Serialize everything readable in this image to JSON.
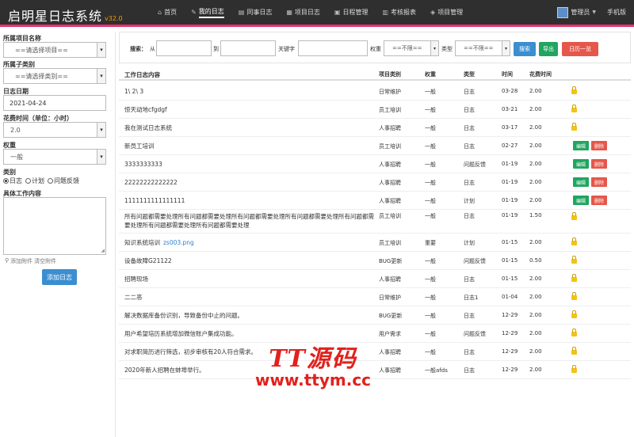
{
  "app": {
    "title": "启明星日志系统",
    "version": "v32.0"
  },
  "nav": [
    {
      "label": "首页",
      "icon": "home-icon",
      "glyph": "⌂"
    },
    {
      "label": "我的日志",
      "icon": "edit-icon",
      "glyph": "✎"
    },
    {
      "label": "同事日志",
      "icon": "list-icon",
      "glyph": "▤"
    },
    {
      "label": "项目日志",
      "icon": "grid-icon",
      "glyph": "▦"
    },
    {
      "label": "日程管理",
      "icon": "calendar-icon",
      "glyph": "▣"
    },
    {
      "label": "考核报表",
      "icon": "chart-icon",
      "glyph": "▥"
    },
    {
      "label": "项目管理",
      "icon": "tag-icon",
      "glyph": "◈"
    }
  ],
  "user": {
    "name": "管理员",
    "mobile": "手机版"
  },
  "form": {
    "project_label": "所属项目名称",
    "project_value": "==请选择项目==",
    "category_label": "所属子类别",
    "category_value": "==请选择类别==",
    "date_label": "日志日期",
    "date_value": "2021-04-24",
    "hours_label": "花费时间（单位：小时）",
    "hours_value": "2.0",
    "weight_label": "权重",
    "weight_value": "一般",
    "type_label": "类别",
    "types": [
      "日志",
      "计划",
      "问题反馈"
    ],
    "content_label": "具体工作内容",
    "attach_label": "添加附件",
    "clear_label": "清空附件",
    "submit_label": "添加日志"
  },
  "search": {
    "label": "搜索：",
    "from": "从",
    "to": "到",
    "keyword": "关键字",
    "weight": "权重",
    "weight_value": "==不限==",
    "type": "类型",
    "type_value": "==不限==",
    "search_btn": "搜索",
    "export_btn": "导出",
    "calendar_btn": "日历一览"
  },
  "table": {
    "headers": [
      "工作日志内容",
      "项目类别",
      "权重",
      "类型",
      "时间",
      "花费时间"
    ],
    "edit_label": "编辑",
    "delete_label": "删除",
    "rows": [
      {
        "content": "1\\ 2\\ 3",
        "cat": "日常维护",
        "weight": "一般",
        "type": "日志",
        "time": "03-28",
        "hours": "2.00",
        "ops": false
      },
      {
        "content": "惊天动地cfgdgf",
        "cat": "员工培训",
        "weight": "一般",
        "type": "日志",
        "time": "03-21",
        "hours": "2.00",
        "ops": false
      },
      {
        "content": "我在测试日志系统",
        "cat": "人事招聘",
        "weight": "一般",
        "type": "日志",
        "time": "03-17",
        "hours": "2.00",
        "ops": false
      },
      {
        "content": "新员工培训",
        "cat": "员工培训",
        "weight": "一般",
        "type": "日志",
        "time": "02-27",
        "hours": "2.00",
        "ops": true
      },
      {
        "content": "3333333333",
        "cat": "人事招聘",
        "weight": "一般",
        "type": "问题反馈",
        "time": "01-19",
        "hours": "2.00",
        "ops": true
      },
      {
        "content": "22222222222222",
        "cat": "人事招聘",
        "weight": "一般",
        "type": "日志",
        "time": "01-19",
        "hours": "2.00",
        "ops": true
      },
      {
        "content": "1111111111111111",
        "cat": "人事招聘",
        "weight": "一般",
        "type": "计划",
        "time": "01-19",
        "hours": "2.00",
        "ops": true
      },
      {
        "content": "所有问题都需要处理所有问题都需要处理所有问题都需要处理所有问题都需要处理所有问题都需要处理所有问题都需要处理所有问题都需要处理",
        "cat": "员工培训",
        "weight": "一般",
        "type": "日志",
        "time": "01-19",
        "hours": "1.50",
        "ops": false,
        "tall": true
      },
      {
        "content": "知识系统培训",
        "attachment": "zs003.png",
        "cat": "员工培训",
        "weight": "重要",
        "type": "计划",
        "time": "01-15",
        "hours": "2.00",
        "ops": false
      },
      {
        "content": "设备故障G21122",
        "cat": "BUG更新",
        "weight": "一般",
        "type": "问题反馈",
        "time": "01-15",
        "hours": "0.50",
        "ops": false
      },
      {
        "content": "招聘现场",
        "cat": "人事招聘",
        "weight": "一般",
        "type": "日志",
        "time": "01-15",
        "hours": "2.00",
        "ops": false
      },
      {
        "content": "二二恶",
        "cat": "日常维护",
        "weight": "一般",
        "type": "日志1",
        "time": "01-04",
        "hours": "2.00",
        "ops": false
      },
      {
        "content": "解决数据库备份识别，导致备份中止的问题。",
        "cat": "BUG更新",
        "weight": "一般",
        "type": "日志",
        "time": "12-29",
        "hours": "2.00",
        "ops": false
      },
      {
        "content": "用户希望培历系统增加微信账户集成功能。",
        "cat": "用户需求",
        "weight": "一般",
        "type": "问题反馈",
        "time": "12-29",
        "hours": "2.00",
        "ops": false
      },
      {
        "content": "对求职简历进行筛选，初步审核有20人符合需求。",
        "cat": "人事招聘",
        "weight": "一般",
        "type": "日志",
        "time": "12-29",
        "hours": "2.00",
        "ops": false
      },
      {
        "content": "2020年新人招聘在蚌埠举行。",
        "cat": "人事招聘",
        "weight": "一般afds",
        "type": "日志",
        "time": "12-29",
        "hours": "2.00",
        "ops": false
      }
    ]
  },
  "watermark": {
    "line1": "TT源码",
    "line2": "www.ttym.cc"
  },
  "colors": {
    "navbar": "#2f2f2f",
    "accent": "#e5316f",
    "primary": "#3b8ed0",
    "success": "#21a55f",
    "danger": "#e5574a",
    "watermark": "#e2211c"
  }
}
